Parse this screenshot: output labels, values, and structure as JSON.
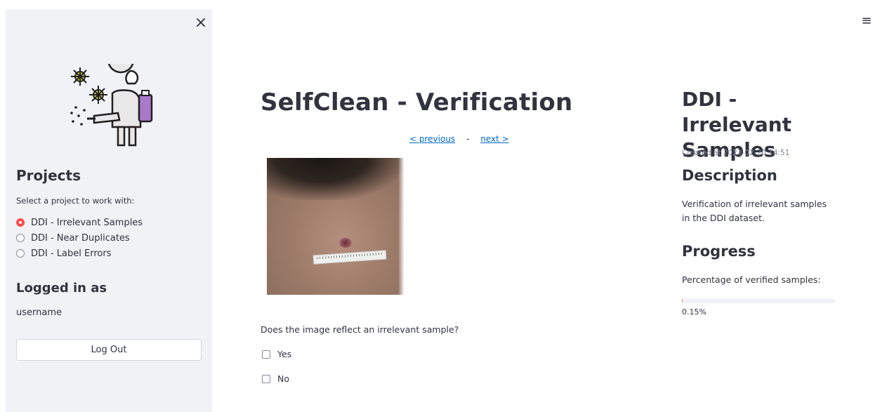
{
  "sidebar": {
    "close_label": "×",
    "projects_heading": "Projects",
    "select_prompt": "Select a project to work with:",
    "projects": [
      {
        "label": "DDI - Irrelevant Samples",
        "selected": true
      },
      {
        "label": "DDI - Near Duplicates",
        "selected": false
      },
      {
        "label": "DDI - Label Errors",
        "selected": false
      }
    ],
    "logged_in_heading": "Logged in as",
    "username": "username",
    "logout_label": "Log Out"
  },
  "header": {
    "menu_icon": "≡"
  },
  "main": {
    "title": "SelfClean - Verification",
    "nav": {
      "previous_label": "< previous",
      "separator": "-",
      "next_label": "next >"
    },
    "question": "Does the image reflect an irrelevant sample?",
    "options": [
      "Yes",
      "No"
    ]
  },
  "details": {
    "title": "DDI - Irrelevant Samples",
    "created": "Created at 2023-02-20 14:51",
    "description_heading": "Description",
    "description": "Verification of irrelevant samples in the DDI dataset.",
    "progress_heading": "Progress",
    "progress_label": "Percentage of verified samples:",
    "progress_value": "0.15%",
    "progress_fraction": 0.0015
  },
  "colors": {
    "accent": "#ff4b4b",
    "link": "#0068c9",
    "sidebar_bg": "#f0f2f6",
    "text": "#31333f"
  },
  "icons": {
    "close": "close-icon",
    "menu": "hamburger-menu-icon",
    "logo": "virus-sprayer-logo-icon"
  }
}
